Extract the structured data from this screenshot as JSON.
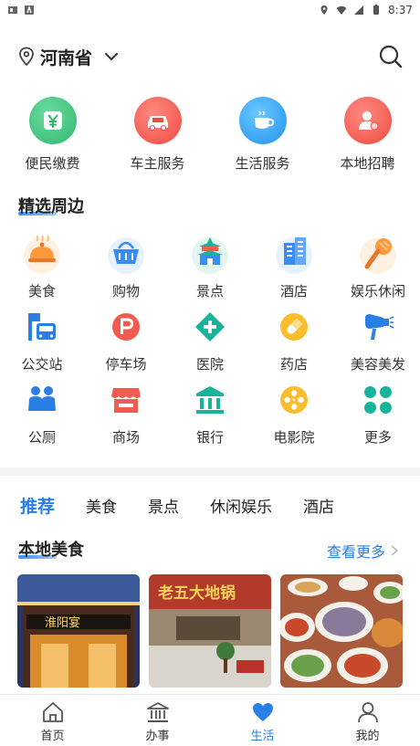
{
  "status_bar": {
    "time": "8:37"
  },
  "header": {
    "province": "河南省"
  },
  "quick_services": [
    {
      "label": "便民缴费",
      "icon": "yuan-icon",
      "color": "#38c17a"
    },
    {
      "label": "车主服务",
      "icon": "car-icon",
      "color": "#f25b50"
    },
    {
      "label": "生活服务",
      "icon": "coffee-icon",
      "color": "#2a9ff0"
    },
    {
      "label": "本地招聘",
      "icon": "recruit-icon",
      "color": "#f2594e"
    }
  ],
  "nearby": {
    "title": "精选周边",
    "items": [
      {
        "label": "美食"
      },
      {
        "label": "购物"
      },
      {
        "label": "景点"
      },
      {
        "label": "酒店"
      },
      {
        "label": "娱乐休闲"
      },
      {
        "label": "公交站"
      },
      {
        "label": "停车场"
      },
      {
        "label": "医院"
      },
      {
        "label": "药店"
      },
      {
        "label": "美容美发"
      },
      {
        "label": "公厕"
      },
      {
        "label": "商场"
      },
      {
        "label": "银行"
      },
      {
        "label": "电影院"
      },
      {
        "label": "更多"
      }
    ]
  },
  "tabs": [
    {
      "label": "推荐"
    },
    {
      "label": "美食"
    },
    {
      "label": "景点"
    },
    {
      "label": "休闲娱乐"
    },
    {
      "label": "酒店"
    }
  ],
  "local_food": {
    "title": "本地美食",
    "more": "查看更多",
    "card_signs": [
      "淮阳宴",
      "老五大地锅"
    ]
  },
  "bottom_nav": [
    {
      "label": "首页"
    },
    {
      "label": "办事"
    },
    {
      "label": "生活"
    },
    {
      "label": "我的"
    }
  ],
  "accent_color": "#2a7fe6"
}
